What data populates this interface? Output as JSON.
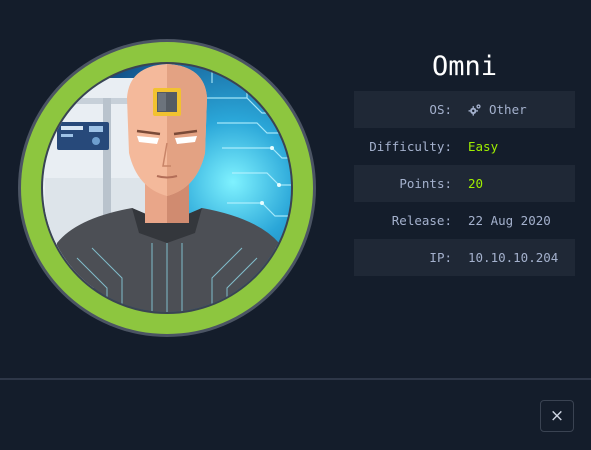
{
  "machine": {
    "name": "Omni",
    "avatar_icon": "android-head-avatar"
  },
  "details": [
    {
      "label": "OS:",
      "value": "Other",
      "icon": "gear-icon"
    },
    {
      "label": "Difficulty:",
      "value": "Easy"
    },
    {
      "label": "Points:",
      "value": "20"
    },
    {
      "label": "Release:",
      "value": "22 Aug 2020"
    },
    {
      "label": "IP:",
      "value": "10.10.10.204"
    }
  ],
  "close_icon": "×",
  "colors": {
    "background": "#141d2b",
    "row_shade": "#1f2836",
    "accent_green": "#9fef00",
    "ring_green": "#8dc63f",
    "label": "#a4b1cd"
  }
}
